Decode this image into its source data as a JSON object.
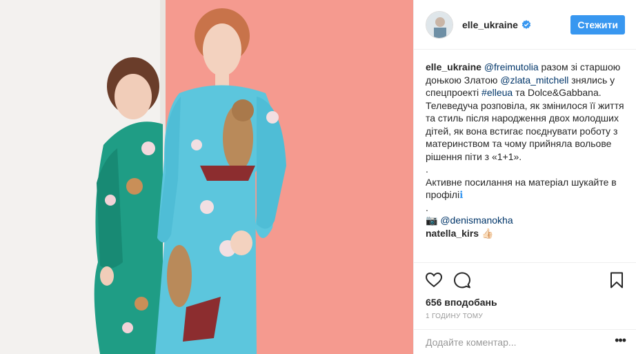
{
  "post": {
    "account": {
      "username": "elle_ukraine",
      "verified": true,
      "follow_label": "Стежити"
    },
    "caption": {
      "author": "elle_ukraine",
      "line1_mention": "@freimutolia",
      "line1_text": " разом зі старшою доњкою Златою ",
      "line1_mention2": "@zlata_mitchell",
      "line1_text2": " знялись у спецпроекті ",
      "hashtag": "#elleua",
      "line1_text3": " та Dolce&Gabbana. Телеведуча розповіла, як змінилося її життя та стиль після народження двох молодших дітей, як вона встигає поєднувати роботу з материнством та чому прийняла вольове рішення піти з «1+1».",
      "dot1": ".",
      "para2": "Активне посилання на матеріал шукайте в профілі",
      "para2_emoji": "ℹ",
      "dot2": ".",
      "camera_emoji": "📷",
      "photographer": "@denismanokha"
    },
    "comments": [
      {
        "username": "natella_kirs",
        "text": "👍🏻"
      }
    ],
    "likes": "656 вподобань",
    "timestamp": "1 ГОДИНУ ТОМУ",
    "add_comment_placeholder": "Додайте коментар...",
    "more_label": "•••"
  },
  "icons": {
    "like": "heart-icon",
    "comment": "comment-icon",
    "save": "bookmark-icon",
    "verified": "verified-badge-icon"
  },
  "colors": {
    "follow_button": "#3897f0",
    "link": "#003569",
    "muted": "#999999",
    "verified": "#3897f0"
  }
}
